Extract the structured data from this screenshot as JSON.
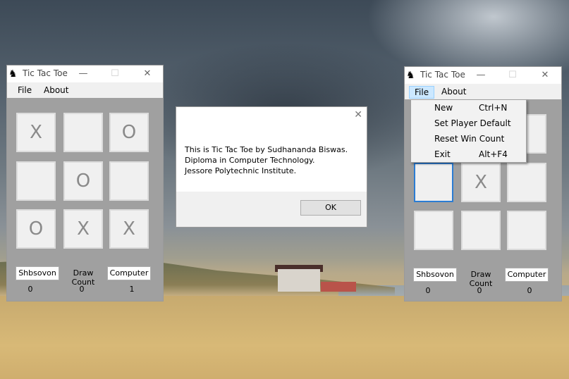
{
  "left_window": {
    "title": "Tic Tac Toe",
    "minimize": "—",
    "maximize": "☐",
    "close": "✕",
    "menu": [
      "File",
      "About"
    ],
    "board": [
      "X",
      "",
      "O",
      "",
      "O",
      "",
      "O",
      "X",
      "X"
    ],
    "player_button": "Shbsovon",
    "draw_label": "Draw Count",
    "computer_button": "Computer",
    "player_score": "0",
    "draw_score": "0",
    "computer_score": "1"
  },
  "right_window": {
    "title": "Tic Tac Toe",
    "minimize": "—",
    "maximize": "☐",
    "close": "✕",
    "menu": [
      "File",
      "About"
    ],
    "board": [
      "",
      "",
      "",
      "",
      "X",
      "",
      "",
      "",
      ""
    ],
    "player_button": "Shbsovon",
    "draw_label": "Draw Count",
    "computer_button": "Computer",
    "player_score": "0",
    "draw_score": "0",
    "computer_score": "0"
  },
  "file_menu": [
    {
      "label": "New",
      "shortcut": "Ctrl+N"
    },
    {
      "label": "Set Player Default",
      "shortcut": ""
    },
    {
      "label": "Reset Win Count",
      "shortcut": ""
    },
    {
      "label": "Exit",
      "shortcut": "Alt+F4"
    }
  ],
  "dialog": {
    "close": "✕",
    "line1": "This is Tic Tac Toe by Sudhananda Biswas.",
    "line2": "Diploma in Computer Technology.",
    "line3": "Jessore Polytechnic Institute.",
    "ok": "OK"
  },
  "icons": {
    "app_icon": "chess-knight-icon"
  },
  "colors": {
    "client_bg": "#a0a0a0",
    "cell_bg": "#f0f0f0",
    "focus": "#2b7cd3"
  }
}
